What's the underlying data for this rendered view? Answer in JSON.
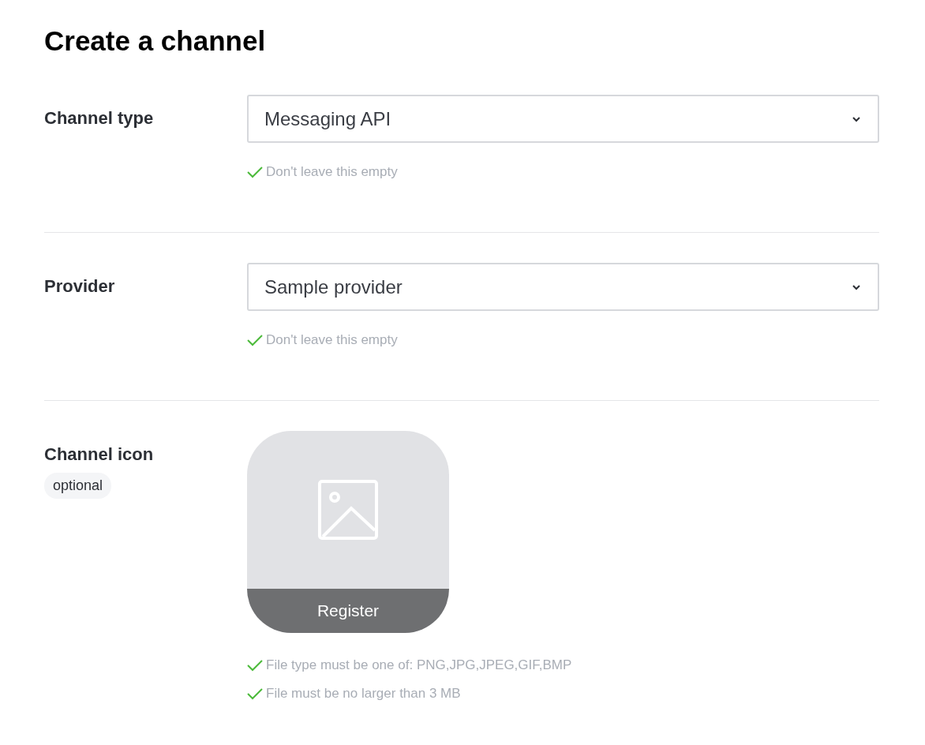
{
  "title": "Create a channel",
  "sections": [
    {
      "kind": "select",
      "label": "Channel type",
      "value": "Messaging API",
      "hints": [
        {
          "text": "Don't leave this empty",
          "passed": true
        }
      ]
    },
    {
      "kind": "select",
      "label": "Provider",
      "value": "Sample provider",
      "hints": [
        {
          "text": "Don't leave this empty",
          "passed": true
        }
      ]
    },
    {
      "kind": "image-upload",
      "label": "Channel icon",
      "badge": "optional",
      "button": "Register",
      "hints": [
        {
          "text": "File type must be one of: PNG,JPG,JPEG,GIF,BMP",
          "passed": true
        },
        {
          "text": "File must be no larger than 3 MB",
          "passed": true
        }
      ]
    }
  ]
}
